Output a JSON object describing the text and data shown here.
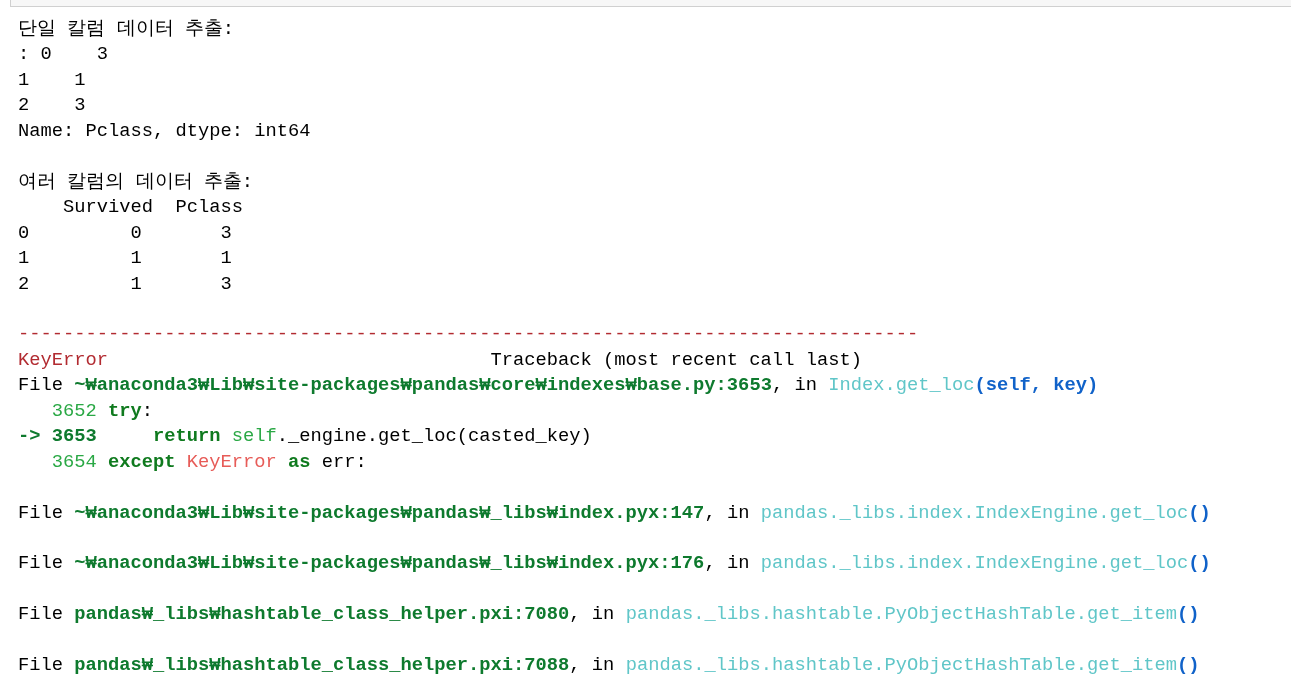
{
  "output_lines": [
    {
      "kind": "text",
      "segments": [
        {
          "kind": "plain",
          "text": "단일 칼럼 데이터 추출:"
        }
      ]
    },
    {
      "kind": "text",
      "segments": [
        {
          "kind": "plain",
          "text": ": 0    3"
        }
      ]
    },
    {
      "kind": "text",
      "segments": [
        {
          "kind": "plain",
          "text": "1    1"
        }
      ]
    },
    {
      "kind": "text",
      "segments": [
        {
          "kind": "plain",
          "text": "2    3"
        }
      ]
    },
    {
      "kind": "text",
      "segments": [
        {
          "kind": "plain",
          "text": "Name: Pclass, dtype: int64"
        }
      ]
    },
    {
      "kind": "blank"
    },
    {
      "kind": "text",
      "segments": [
        {
          "kind": "plain",
          "text": "여러 칼럼의 데이터 추출:"
        }
      ]
    },
    {
      "kind": "text",
      "segments": [
        {
          "kind": "plain",
          "text": "    Survived  Pclass"
        }
      ]
    },
    {
      "kind": "text",
      "segments": [
        {
          "kind": "plain",
          "text": "0         0       3"
        }
      ]
    },
    {
      "kind": "text",
      "segments": [
        {
          "kind": "plain",
          "text": "1         1       1"
        }
      ]
    },
    {
      "kind": "text",
      "segments": [
        {
          "kind": "plain",
          "text": "2         1       3"
        }
      ]
    },
    {
      "kind": "blank"
    },
    {
      "kind": "text",
      "segments": [
        {
          "kind": "error",
          "text": "--------------------------------------------------------------------------------"
        }
      ]
    },
    {
      "kind": "text",
      "segments": [
        {
          "kind": "error",
          "text": "KeyError"
        },
        {
          "kind": "plain",
          "text": "                                  Traceback (most recent call last)"
        }
      ]
    },
    {
      "kind": "text",
      "segments": [
        {
          "kind": "plain",
          "text": "File "
        },
        {
          "kind": "path",
          "text": "~₩anaconda3₩Lib₩site-packages₩pandas₩core₩indexes₩base.py:3653"
        },
        {
          "kind": "plain",
          "text": ", in "
        },
        {
          "kind": "func",
          "text": "Index.get_loc"
        },
        {
          "kind": "paren",
          "text": "(self, key)"
        }
      ]
    },
    {
      "kind": "text",
      "segments": [
        {
          "kind": "lineno",
          "text": "   3652 "
        },
        {
          "kind": "keyword",
          "text": "try"
        },
        {
          "kind": "plain",
          "text": ":"
        }
      ]
    },
    {
      "kind": "text",
      "segments": [
        {
          "kind": "path",
          "text": "-> 3653     "
        },
        {
          "kind": "keyword",
          "text": "return "
        },
        {
          "kind": "lineno",
          "text": "self"
        },
        {
          "kind": "plain",
          "text": "._engine.get_loc(casted_key)"
        }
      ]
    },
    {
      "kind": "text",
      "segments": [
        {
          "kind": "lineno",
          "text": "   3654 "
        },
        {
          "kind": "keyword",
          "text": "except "
        },
        {
          "kind": "exc",
          "text": "KeyError "
        },
        {
          "kind": "keyword",
          "text": "as "
        },
        {
          "kind": "plain",
          "text": "err:"
        }
      ]
    },
    {
      "kind": "blank"
    },
    {
      "kind": "text",
      "segments": [
        {
          "kind": "plain",
          "text": "File "
        },
        {
          "kind": "path",
          "text": "~₩anaconda3₩Lib₩site-packages₩pandas₩_libs₩index.pyx:147"
        },
        {
          "kind": "plain",
          "text": ", in "
        },
        {
          "kind": "func",
          "text": "pandas._libs.index.IndexEngine.get_loc"
        },
        {
          "kind": "paren",
          "text": "()"
        }
      ]
    },
    {
      "kind": "blank"
    },
    {
      "kind": "text",
      "segments": [
        {
          "kind": "plain",
          "text": "File "
        },
        {
          "kind": "path",
          "text": "~₩anaconda3₩Lib₩site-packages₩pandas₩_libs₩index.pyx:176"
        },
        {
          "kind": "plain",
          "text": ", in "
        },
        {
          "kind": "func",
          "text": "pandas._libs.index.IndexEngine.get_loc"
        },
        {
          "kind": "paren",
          "text": "()"
        }
      ]
    },
    {
      "kind": "blank"
    },
    {
      "kind": "text",
      "segments": [
        {
          "kind": "plain",
          "text": "File "
        },
        {
          "kind": "path",
          "text": "pandas₩_libs₩hashtable_class_helper.pxi:7080"
        },
        {
          "kind": "plain",
          "text": ", in "
        },
        {
          "kind": "func",
          "text": "pandas._libs.hashtable.PyObjectHashTable.get_item"
        },
        {
          "kind": "paren",
          "text": "()"
        }
      ]
    },
    {
      "kind": "blank"
    },
    {
      "kind": "text",
      "segments": [
        {
          "kind": "plain",
          "text": "File "
        },
        {
          "kind": "path",
          "text": "pandas₩_libs₩hashtable_class_helper.pxi:7088"
        },
        {
          "kind": "plain",
          "text": ", in "
        },
        {
          "kind": "func",
          "text": "pandas._libs.hashtable.PyObjectHashTable.get_item"
        },
        {
          "kind": "paren",
          "text": "()"
        }
      ]
    }
  ]
}
